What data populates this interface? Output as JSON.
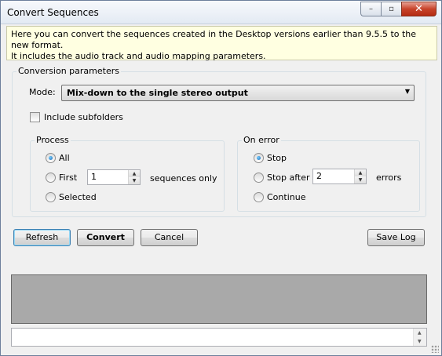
{
  "window": {
    "title": "Convert Sequences",
    "controls": {
      "minimize": "–",
      "maximize": "▫",
      "close": "✕"
    }
  },
  "info": {
    "line1": "Here you can convert the sequences created in the Desktop versions earlier than 9.5.5 to the new format.",
    "line2": "It includes the audio track and audio mapping parameters."
  },
  "params": {
    "title": "Conversion parameters",
    "mode_label": "Mode:",
    "mode_value": "Mix-down to the single stereo output",
    "include_subfolders": {
      "label": "Include subfolders",
      "checked": false
    }
  },
  "process": {
    "title": "Process",
    "all": {
      "label": "All",
      "checked": true
    },
    "first": {
      "label": "First",
      "checked": false,
      "value": "1",
      "suffix": "sequences only"
    },
    "selected": {
      "label": "Selected",
      "checked": false
    }
  },
  "on_error": {
    "title": "On error",
    "stop": {
      "label": "Stop",
      "checked": true
    },
    "stop_after": {
      "label": "Stop after",
      "checked": false,
      "value": "2",
      "suffix": "errors"
    },
    "continue": {
      "label": "Continue",
      "checked": false
    }
  },
  "buttons": {
    "refresh": "Refresh",
    "convert": "Convert",
    "cancel": "Cancel",
    "save_log": "Save Log"
  },
  "colors": {
    "info_background": "#ffffe1",
    "progress_area": "#a9a9a9",
    "window_background": "#f0f0f0"
  }
}
